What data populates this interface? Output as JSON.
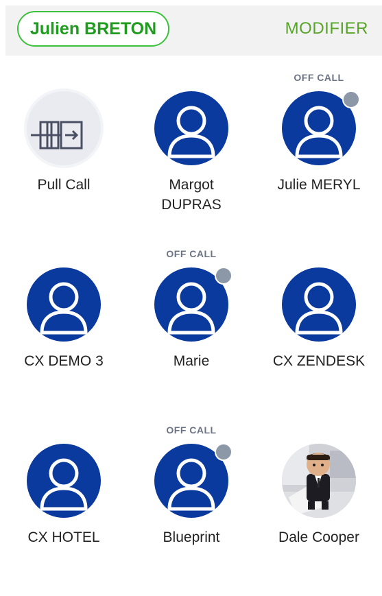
{
  "header": {
    "user_name": "Julien BRETON",
    "edit_label": "MODIFIER"
  },
  "colors": {
    "accent_green": "#3cc13c",
    "avatar_blue": "#0a3a9e",
    "status_dot": "#8c97a8"
  },
  "contacts": [
    {
      "name": "Pull Call",
      "status": "",
      "avatar": "pull-call-icon"
    },
    {
      "name": "Margot DUPRAS",
      "status": "",
      "avatar": "person-icon"
    },
    {
      "name": "Julie MERYL",
      "status": "OFF CALL",
      "avatar": "person-icon"
    },
    {
      "name": "CX DEMO 3",
      "status": "",
      "avatar": "person-icon"
    },
    {
      "name": "Marie",
      "status": "OFF CALL",
      "avatar": "person-icon"
    },
    {
      "name": "CX ZENDESK",
      "status": "",
      "avatar": "person-icon"
    },
    {
      "name": "CX HOTEL",
      "status": "",
      "avatar": "person-icon"
    },
    {
      "name": "Blueprint",
      "status": "OFF CALL",
      "avatar": "person-icon"
    },
    {
      "name": "Dale Cooper",
      "status": "",
      "avatar": "photo"
    }
  ]
}
